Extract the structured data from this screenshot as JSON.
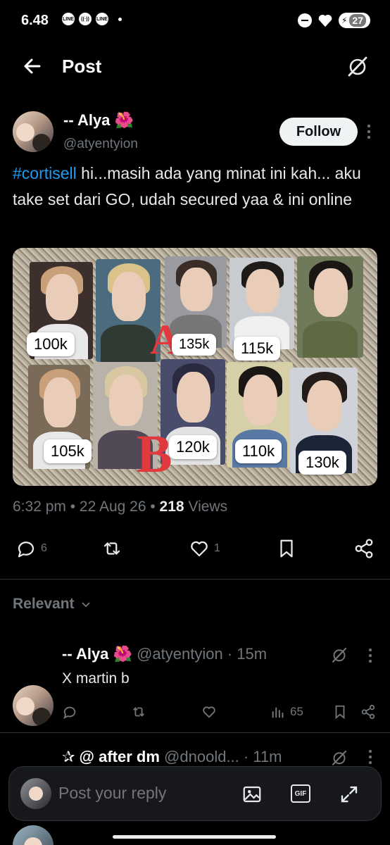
{
  "status_bar": {
    "time": "6.48",
    "battery": "27"
  },
  "header": {
    "title": "Post"
  },
  "post": {
    "author_name": "-- Alya 🌺",
    "author_handle": "@atyentyion",
    "follow_label": "Follow",
    "hashtag": "#cortisell",
    "text": " hi...masih ada yang minat ini kah... aku take set dari GO, udah secured yaa & ini online",
    "image": {
      "letters": [
        "A",
        "B"
      ],
      "prices_row_a": [
        "100k",
        "135k",
        "115k"
      ],
      "prices_row_b": [
        "105k",
        "120k",
        "110k",
        "130k"
      ]
    },
    "time": "6:32 pm",
    "date": "22 Aug 26",
    "views_count": "218",
    "views_label": "Views",
    "replies_count": "6",
    "likes_count": "1"
  },
  "relevant_label": "Relevant",
  "replies": [
    {
      "name": "-- Alya 🌺",
      "handle": "@atyentyion",
      "time": "15m",
      "text": "X martin b",
      "views": "65"
    },
    {
      "name": "✰ @ after dm",
      "handle": "@dnoold...",
      "time": "11m"
    }
  ],
  "compose": {
    "placeholder": "Post your reply",
    "gif_label": "GIF"
  },
  "colors": {
    "link": "#1d9bf0",
    "muted": "#71767b",
    "background": "#000000"
  }
}
